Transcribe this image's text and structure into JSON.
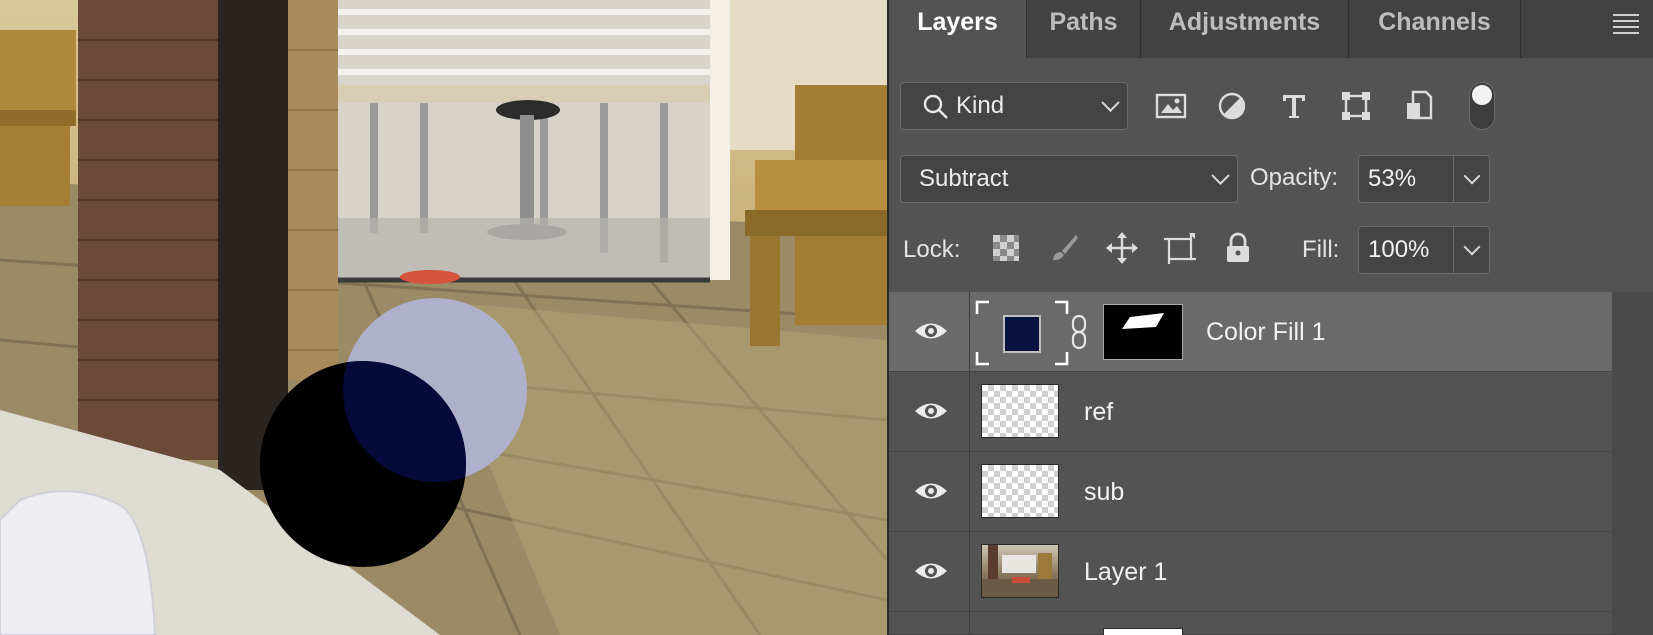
{
  "canvas": {
    "description_name": "photo-canvas"
  },
  "panel": {
    "tabs": [
      {
        "label": "Layers",
        "active": true
      },
      {
        "label": "Paths",
        "active": false
      },
      {
        "label": "Adjustments",
        "active": false
      },
      {
        "label": "Channels",
        "active": false
      }
    ],
    "filter": {
      "kind_label": "Kind"
    },
    "blend_mode": "Subtract",
    "opacity": {
      "label": "Opacity:",
      "value": "53%"
    },
    "lock": {
      "label": "Lock:"
    },
    "fill": {
      "label": "Fill:",
      "value": "100%"
    },
    "layers": [
      {
        "name": "Color Fill 1",
        "selected": true,
        "visible": true,
        "fill_color": "#0a1240"
      },
      {
        "name": "ref",
        "selected": false,
        "visible": true
      },
      {
        "name": "sub",
        "selected": false,
        "visible": true
      },
      {
        "name": "Layer 1",
        "selected": false,
        "visible": true
      }
    ]
  },
  "colors": {
    "panel_bg": "#535353",
    "selected_row": "#6a6a6a",
    "fill_swatch": "#0a1240",
    "circle_light": "#aeb0cc"
  }
}
